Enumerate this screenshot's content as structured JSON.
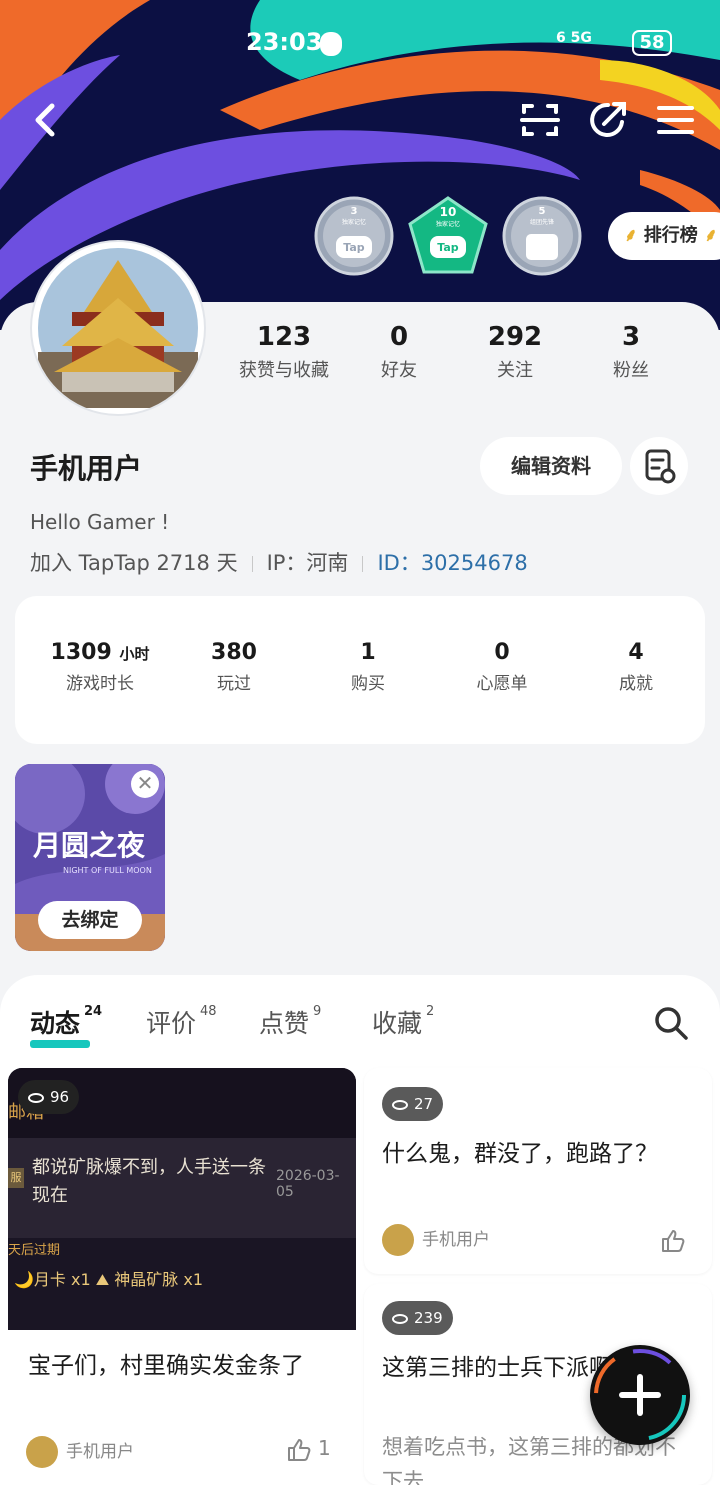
{
  "status_bar": {
    "time": "23:03",
    "network": "6 5G",
    "battery": "58"
  },
  "badges": [
    {
      "num": "3",
      "label": "独家记忆",
      "logo": "Tap"
    },
    {
      "num": "10",
      "label": "独家记忆",
      "logo": "Tap"
    },
    {
      "num": "5",
      "label": "组团先锋"
    }
  ],
  "rank_button": {
    "label": "排行榜"
  },
  "profile_stats": [
    {
      "num": "123",
      "label": "获赞与收藏"
    },
    {
      "num": "0",
      "label": "好友"
    },
    {
      "num": "292",
      "label": "关注"
    },
    {
      "num": "3",
      "label": "粉丝"
    }
  ],
  "profile": {
    "name": "手机用户",
    "edit_label": "编辑资料",
    "bio": "Hello Gamer !",
    "joined": "加入 TapTap 2718 天",
    "ip": "IP：河南",
    "id_label": "ID：",
    "id_value": "30254678"
  },
  "game_stats": [
    {
      "num": "1309",
      "unit": "小时",
      "label": "游戏时长"
    },
    {
      "num": "380",
      "label": "玩过"
    },
    {
      "num": "1",
      "label": "购买"
    },
    {
      "num": "0",
      "label": "心愿单"
    },
    {
      "num": "4",
      "label": "成就"
    }
  ],
  "promo": {
    "title": "月圆之夜",
    "subtitle": "NIGHT OF FULL MOON",
    "button": "去绑定",
    "close_icon": "✕"
  },
  "tabs": [
    {
      "label": "动态",
      "count": "24"
    },
    {
      "label": "评价",
      "count": "48"
    },
    {
      "label": "点赞",
      "count": "9"
    },
    {
      "label": "收藏",
      "count": "2"
    }
  ],
  "posts": [
    {
      "views": "96",
      "shot": {
        "partial": "邮箱",
        "tag": "服",
        "text": "都说矿脉爆不到，人手送一条现在",
        "date": "2026-03-05",
        "expire": "天后过期",
        "items": "🌙月卡 x1  ⛰ 神晶矿脉 x1"
      },
      "title": "宝子们，村里确实发金条了",
      "author": "手机用户",
      "likes": "1"
    },
    {
      "views": "27",
      "title": "什么鬼，群没了，跑路了？",
      "author": "手机用户"
    },
    {
      "views": "239",
      "title": "这第三排的士兵下派啊",
      "subtitle": "想着吃点书，这第三排的都划不下去"
    }
  ],
  "colors": {
    "accent": "#16c7bd",
    "id_link": "#2d6fa8",
    "banner_bg": "#0c1043"
  }
}
